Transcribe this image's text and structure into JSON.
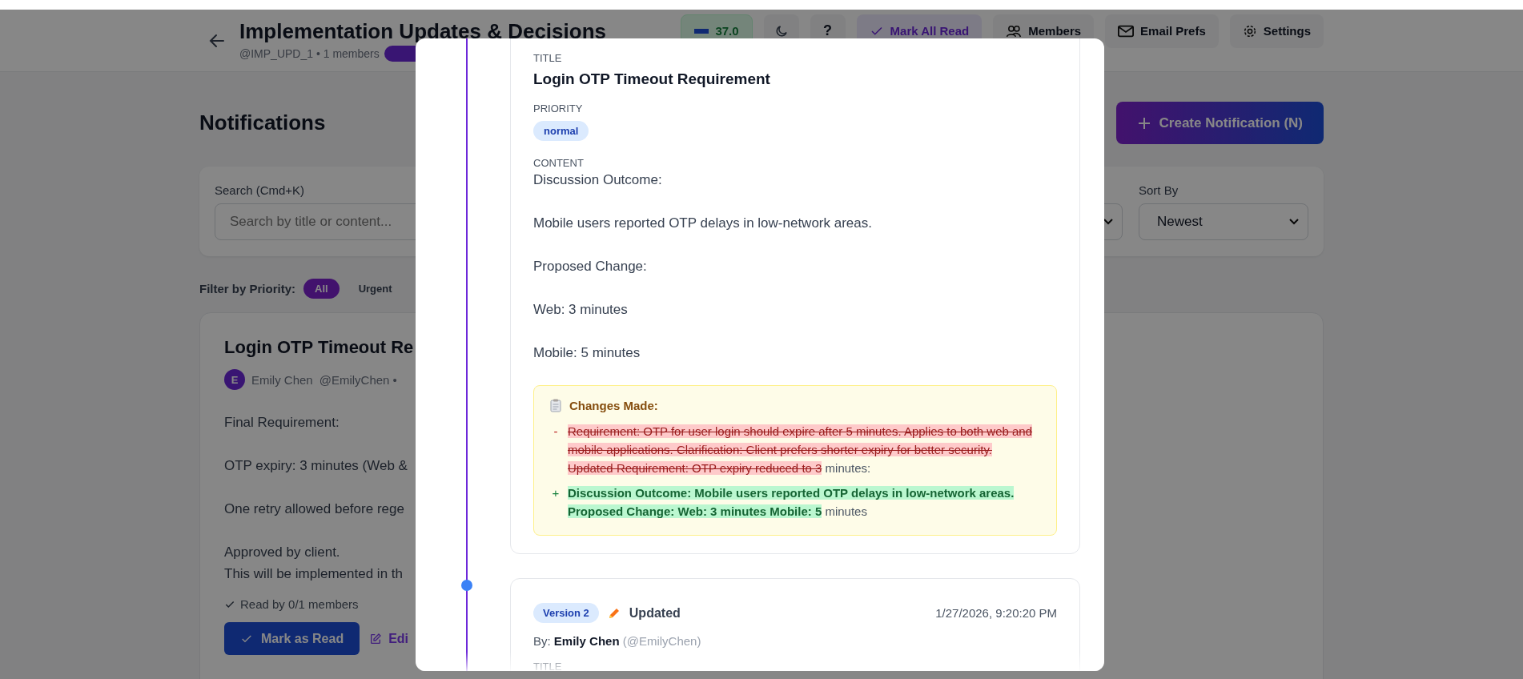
{
  "header": {
    "title": "Implementation Updates & Decisions",
    "subtitle": "@IMP_UPD_1 • 1 members",
    "stat": "37.0",
    "help": "?",
    "buttons": [
      {
        "kind": "mark_read",
        "label": "Mark All Read"
      },
      {
        "kind": "members",
        "label": "Members"
      },
      {
        "kind": "email",
        "label": "Email Prefs"
      },
      {
        "kind": "settings",
        "label": "Settings"
      }
    ]
  },
  "page": {
    "heading": "Notifications",
    "create_button": "Create Notification (N)",
    "search": {
      "label": "Search (Cmd+K)",
      "placeholder": "Search by title or content..."
    },
    "sort": {
      "label": "Sort By",
      "value": "Newest"
    },
    "filter": {
      "label": "Filter by Priority:",
      "options": [
        {
          "label": "All",
          "selected": true
        },
        {
          "label": "Urgent",
          "selected": false
        }
      ]
    },
    "card": {
      "title": "Login OTP Timeout Re",
      "initial": "E",
      "author": "Emily Chen",
      "handle": "@EmilyChen •",
      "paragraphs": [
        [
          "Final Requirement:"
        ],
        [
          "OTP expiry: 3 minutes (Web &"
        ],
        [
          "One retry allowed before rege"
        ],
        [
          "Approved by client.",
          "This will be implemented in th"
        ]
      ],
      "read_by": "Read by 0/1 members",
      "mark_button": "Mark as Read",
      "edit_button": "Edi"
    }
  },
  "modal": {
    "versions": [
      {
        "kind": "detail",
        "title_label": "TITLE",
        "title": "Login OTP Timeout Requirement",
        "priority_label": "PRIORITY",
        "priority": "normal",
        "content_label": "CONTENT",
        "content": [
          "Discussion Outcome:",
          "Mobile users reported OTP delays in low-network areas.",
          "Proposed Change:",
          "Web: 3 minutes",
          "Mobile: 5 minutes"
        ],
        "changes": {
          "heading": "Changes Made:",
          "diffs": [
            {
              "kind": "removed",
              "sign": "-",
              "text": "Requirement: OTP for user login should expire after 5 minutes. Applies to both web and mobile applications. Clarification: Client prefers shorter expiry for better security. Updated Requirement: OTP expiry reduced to 3",
              "tail": "minutes:"
            },
            {
              "kind": "added",
              "sign": "+",
              "text": "Discussion Outcome: Mobile users reported OTP delays in low-network areas. Proposed Change: Web: 3 minutes Mobile: 5",
              "tail": "minutes"
            }
          ]
        }
      },
      {
        "kind": "summary",
        "version": "Version 2",
        "action": "Updated",
        "timestamp": "1/27/2026, 9:20:20 PM",
        "by_label": "By:",
        "author": "Emily Chen",
        "handle": "(@EmilyChen)",
        "title_label": "TITLE"
      }
    ]
  }
}
